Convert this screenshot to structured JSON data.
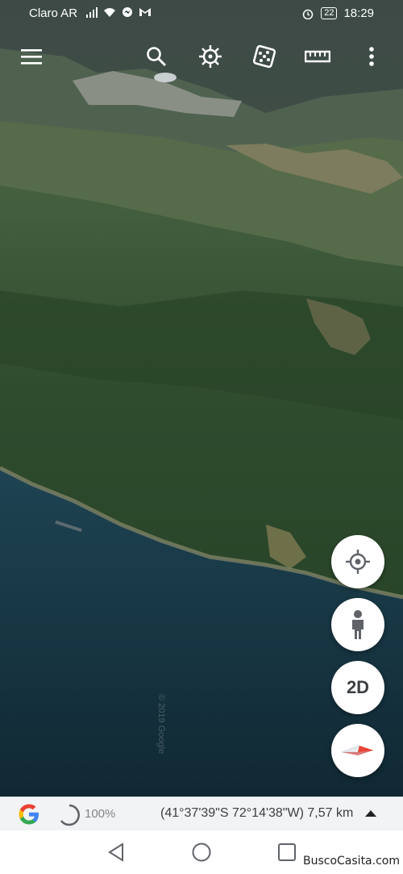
{
  "status_bar": {
    "carrier": "Claro AR",
    "battery": "22",
    "time": "18:29",
    "icons": [
      "signal-icon",
      "wifi-icon",
      "messenger-icon",
      "gmail-icon",
      "alarm-icon"
    ]
  },
  "toolbar": {
    "items": [
      "menu-icon",
      "search-icon",
      "voyager-icon",
      "feeling-lucky-icon",
      "measure-icon",
      "more-options-icon"
    ]
  },
  "fabs": {
    "location": "my-location-icon",
    "street_view": "pegman-icon",
    "mode_label": "2D",
    "compass": "compass-icon"
  },
  "map": {
    "watermark": "© 2019 Google"
  },
  "info_bar": {
    "loading_percent": "100%",
    "coordinates": "(41°37'39\"S 72°14'38\"W) 7,57 km"
  },
  "nav_bar": {
    "watermark": "BuscoCasita.com"
  },
  "colors": {
    "water": "#173747",
    "forest": "#2b4a2c",
    "google_blue": "#4285f4",
    "compass_red": "#ea4335"
  }
}
